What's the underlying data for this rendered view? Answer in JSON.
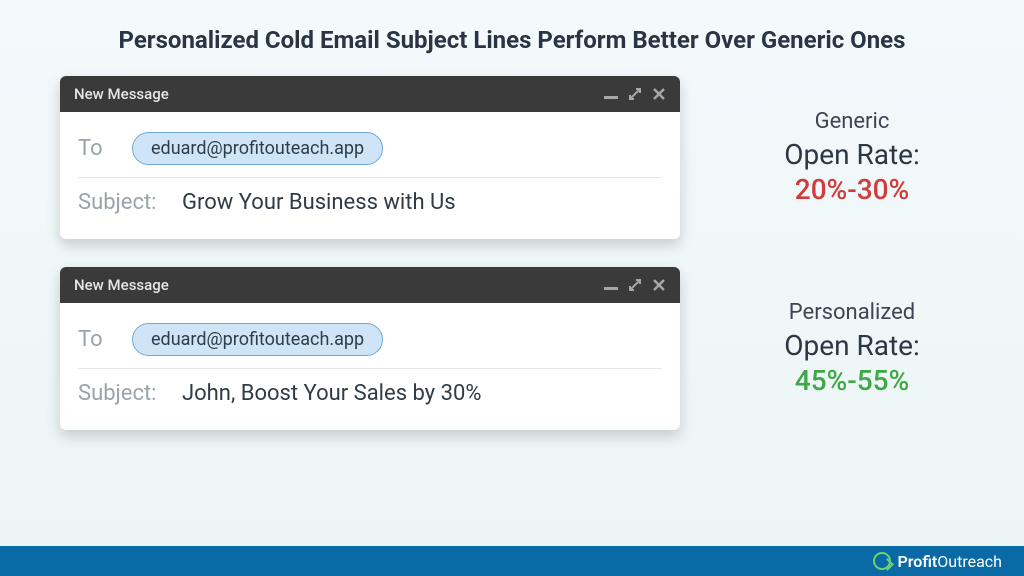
{
  "title": "Personalized Cold Email Subject Lines Perform Better Over Generic Ones",
  "emails": [
    {
      "header": "New Message",
      "to_label": "To",
      "to_value": "eduard@profitouteach.app",
      "subject_label": "Subject:",
      "subject_value": "Grow Your Business with Us"
    },
    {
      "header": "New Message",
      "to_label": "To",
      "to_value": "eduard@profitouteach.app",
      "subject_label": "Subject:",
      "subject_value": "John, Boost Your Sales by 30%"
    }
  ],
  "stats": [
    {
      "category": "Generic",
      "metric": "Open Rate:",
      "value": "20%-30%"
    },
    {
      "category": "Personalized",
      "metric": "Open Rate:",
      "value": "45%-55%"
    }
  ],
  "footer": {
    "brand_part1": "Profit",
    "brand_part2": "Outreach"
  },
  "colors": {
    "red": "#d13b3b",
    "green": "#3ea844",
    "footer_bg": "#0a6aa6",
    "chip_border": "#6fa9da"
  }
}
